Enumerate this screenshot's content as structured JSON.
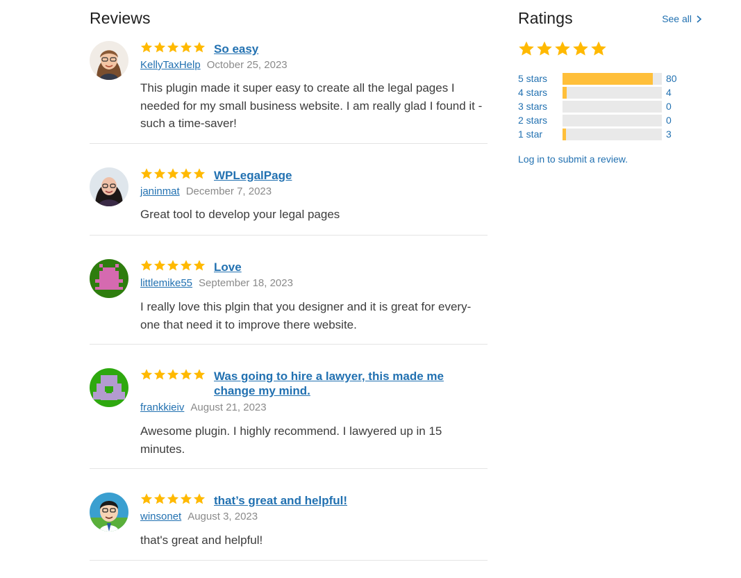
{
  "reviews_heading": "Reviews",
  "ratings_heading": "Ratings",
  "see_all_label": "See all",
  "login_label": "Log in to submit a review.",
  "overall_rating_stars": 5,
  "colors": {
    "star": "#ffb900",
    "link": "#2271b1",
    "bar_fill": "#ffbf3a",
    "bar_bg": "#e9e9e9"
  },
  "reviews": [
    {
      "title": "So easy",
      "author": "KellyTaxHelp",
      "date": "October 25, 2023",
      "text": "This plugin made it super easy to create all the legal pages I needed for my small business website. I am really glad I found it - such a time-saver!",
      "rating": 5
    },
    {
      "title": "WPLegalPage",
      "author": "janinmat",
      "date": "December 7, 2023",
      "text": "Great tool to develop your legal pages",
      "rating": 5
    },
    {
      "title": "Love",
      "author": "littlemike55",
      "date": "September 18, 2023",
      "text": "I really love this plgin that you designer and it is great for every-one that need it to improve there website.",
      "rating": 5
    },
    {
      "title": "Was going to hire a lawyer, this made me change my mind.",
      "author": "frankkieiv",
      "date": "August 21, 2023",
      "text": "Awesome plugin. I highly recommend. I lawyered up in 15 minutes.",
      "rating": 5
    },
    {
      "title": "that’s great and helpful!",
      "author": "winsonet",
      "date": "August 3, 2023",
      "text": "that's great and helpful!",
      "rating": 5
    }
  ],
  "rating_counts": [
    {
      "label": "5 stars",
      "count": "80",
      "fraction": 0.91
    },
    {
      "label": "4 stars",
      "count": "4",
      "fraction": 0.045
    },
    {
      "label": "3 stars",
      "count": "0",
      "fraction": 0
    },
    {
      "label": "2 stars",
      "count": "0",
      "fraction": 0
    },
    {
      "label": "1 star",
      "count": "3",
      "fraction": 0.034
    }
  ]
}
